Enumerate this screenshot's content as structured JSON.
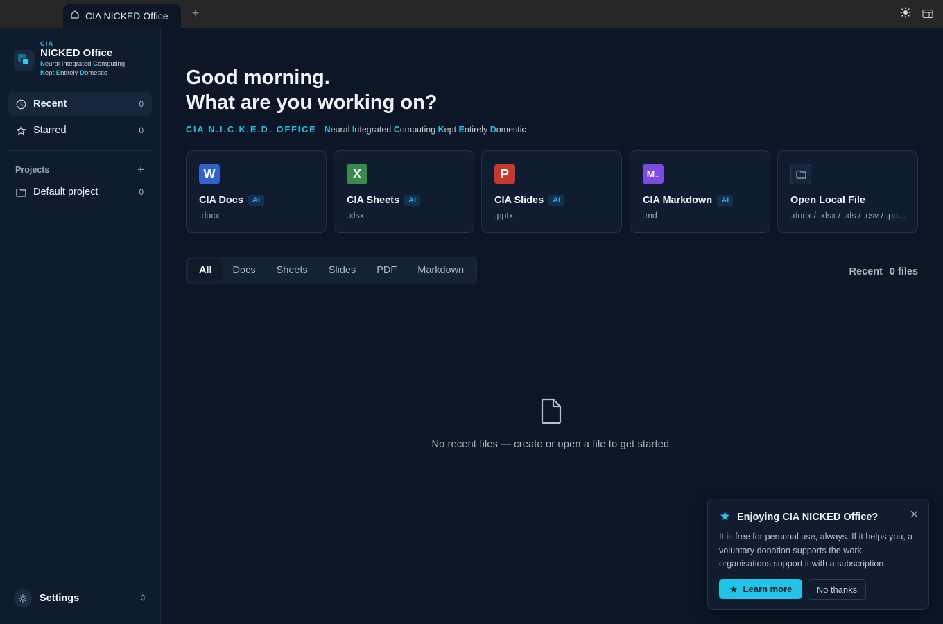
{
  "tab": {
    "title": "CIA NICKED Office",
    "add_label": "+"
  },
  "titlebar_icons": [
    "sun-icon",
    "panel-toggle-icon"
  ],
  "brand": {
    "cia": "CIA",
    "name": "NICKED Office",
    "line1": [
      {
        "h": "N",
        "t": "eural "
      },
      {
        "h": "I",
        "t": "ntegrated "
      },
      {
        "h": "C",
        "t": "omputing"
      }
    ],
    "line2": [
      {
        "h": "K",
        "t": "ept "
      },
      {
        "h": "E",
        "t": "ntirely "
      },
      {
        "h": "D",
        "t": "omestic"
      }
    ]
  },
  "sidebar": {
    "recent": {
      "label": "Recent",
      "count": "0"
    },
    "starred": {
      "label": "Starred",
      "count": "0"
    },
    "projects_label": "Projects",
    "projects_add": "+",
    "default_project": {
      "label": "Default project",
      "count": "0"
    },
    "settings_label": "Settings"
  },
  "main": {
    "greeting1": "Good morning.",
    "greeting2": "What are you working on?",
    "brand_line": "CIA N.I.C.K.E.D. OFFICE",
    "expansion": [
      {
        "h": "N",
        "t": "eural "
      },
      {
        "h": "I",
        "t": "ntegrated "
      },
      {
        "h": "C",
        "t": "omputing "
      },
      {
        "h": "K",
        "t": "ept "
      },
      {
        "h": "E",
        "t": "ntirely "
      },
      {
        "h": "D",
        "t": "omestic"
      }
    ],
    "cards": [
      {
        "icon": "W",
        "color": "#2f63c9",
        "title": "CIA Docs",
        "ai": "AI",
        "ext": ".docx"
      },
      {
        "icon": "X",
        "color": "#3a8a4c",
        "title": "CIA Sheets",
        "ai": "AI",
        "ext": ".xlsx"
      },
      {
        "icon": "P",
        "color": "#c7382a",
        "title": "CIA Slides",
        "ai": "AI",
        "ext": ".pptx"
      },
      {
        "icon": "M↓",
        "color": "#7c4be0",
        "title": "CIA Markdown",
        "ai": "AI",
        "ext": ".md"
      },
      {
        "icon": "folder",
        "color": "",
        "title": "Open Local File",
        "ai": "",
        "ext": ".docx / .xlsx / .xls / .csv / .pptx / .md / .pdf"
      }
    ],
    "filters": [
      "All",
      "Docs",
      "Sheets",
      "Slides",
      "PDF",
      "Markdown"
    ],
    "active_filter": "All",
    "recent_label": "Recent",
    "files_count": "0 files",
    "empty_message": "No recent files — create or open a file to get started."
  },
  "toast": {
    "title": "Enjoying CIA NICKED Office?",
    "body": "It is free for personal use, always. If it helps you, a voluntary donation supports the work — organisations support it with a subscription.",
    "learn_more": "Learn more",
    "no_thanks": "No thanks"
  },
  "colors": {
    "accent": "#22c3e6",
    "background": "#0c1626",
    "sidebar": "#0f1c2e"
  }
}
